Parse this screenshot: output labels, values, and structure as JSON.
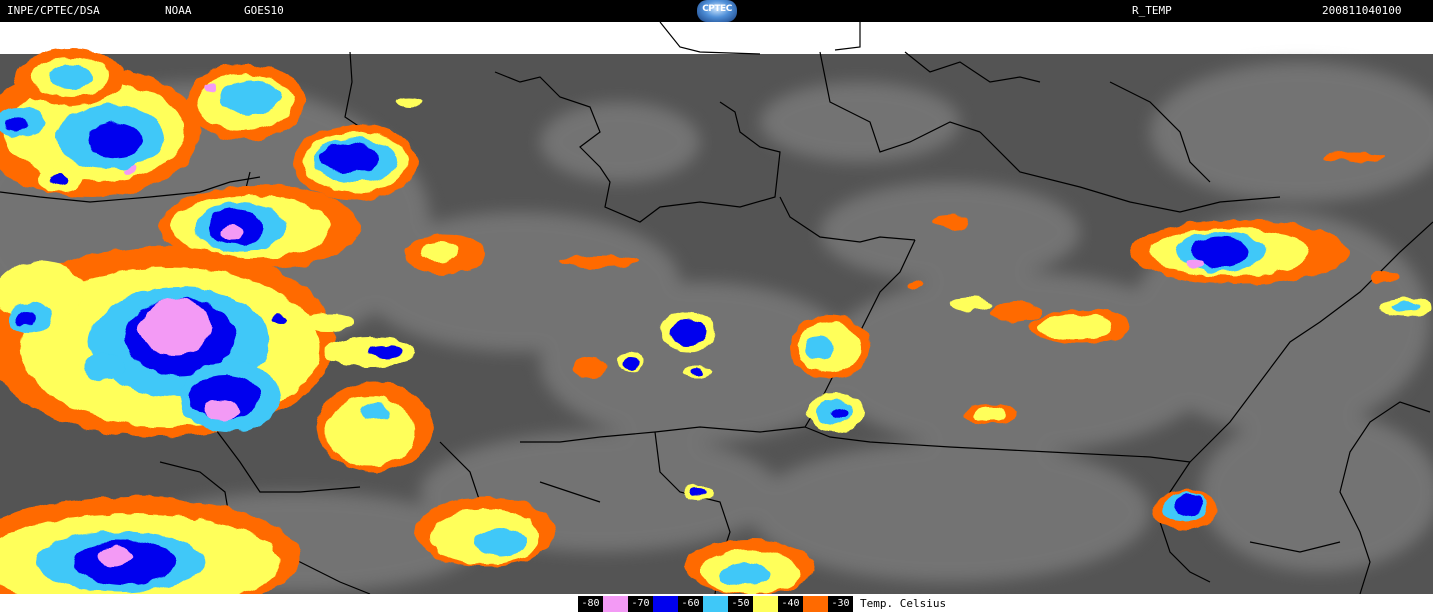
{
  "header": {
    "org": "INPE/CPTEC/DSA",
    "agency": "NOAA",
    "satellite": "GOES10",
    "logo_text": "CPTEC",
    "product": "R_TEMP",
    "datetime": "200811040100"
  },
  "colors": {
    "background_gray": "#555555",
    "cloud_gray": "#9a9a9a",
    "land_blank": "#ffffff",
    "border_line": "#000000"
  },
  "legend": {
    "title": "Temp. Celsius",
    "items": [
      {
        "label": "-80",
        "color": "#f39af5"
      },
      {
        "label": "-70",
        "color": "#0000ee"
      },
      {
        "label": "-60",
        "color": "#3fc8f8"
      },
      {
        "label": "-50",
        "color": "#ffff5a"
      },
      {
        "label": "-40",
        "color": "#ff6a00"
      },
      {
        "label": "-30",
        "color": "#ff6a00"
      }
    ]
  }
}
